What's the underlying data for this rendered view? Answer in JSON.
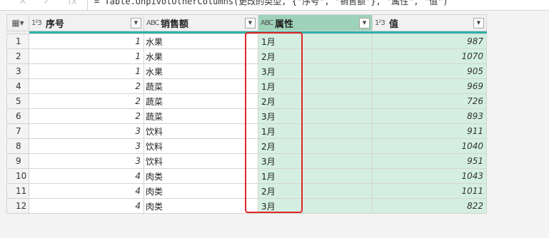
{
  "formula_bar": {
    "text": "= Table.UnpivotOtherColumns(更改的类型, {\"序号\", \"销售额\"}, \"属性\", \"值\")",
    "cancel_icon": "close-icon",
    "confirm_icon": "check-icon",
    "fx_label": "fx"
  },
  "columns": [
    {
      "type_label": "1²3",
      "label": "序号"
    },
    {
      "type_label": "ABC",
      "label": "销售额"
    },
    {
      "type_label": "ABC",
      "label": "属性"
    },
    {
      "type_label": "1²3",
      "label": "值"
    }
  ],
  "rows": [
    {
      "n": "1",
      "seq": "1",
      "cat": "水果",
      "attr": "1月",
      "val": "987"
    },
    {
      "n": "2",
      "seq": "1",
      "cat": "水果",
      "attr": "2月",
      "val": "1070"
    },
    {
      "n": "3",
      "seq": "1",
      "cat": "水果",
      "attr": "3月",
      "val": "905"
    },
    {
      "n": "4",
      "seq": "2",
      "cat": "蔬菜",
      "attr": "1月",
      "val": "969"
    },
    {
      "n": "5",
      "seq": "2",
      "cat": "蔬菜",
      "attr": "2月",
      "val": "726"
    },
    {
      "n": "6",
      "seq": "2",
      "cat": "蔬菜",
      "attr": "3月",
      "val": "893"
    },
    {
      "n": "7",
      "seq": "3",
      "cat": "饮料",
      "attr": "1月",
      "val": "911"
    },
    {
      "n": "8",
      "seq": "3",
      "cat": "饮料",
      "attr": "2月",
      "val": "1040"
    },
    {
      "n": "9",
      "seq": "3",
      "cat": "饮料",
      "attr": "3月",
      "val": "951"
    },
    {
      "n": "10",
      "seq": "4",
      "cat": "肉类",
      "attr": "1月",
      "val": "1043"
    },
    {
      "n": "11",
      "seq": "4",
      "cat": "肉类",
      "attr": "2月",
      "val": "1011"
    },
    {
      "n": "12",
      "seq": "4",
      "cat": "肉类",
      "attr": "3月",
      "val": "822"
    }
  ],
  "colors": {
    "selected_header": "#9ed3b9",
    "selected_cells": "#d4efe2",
    "accent_bar": "#2fb1a6",
    "highlight_border": "#e02626"
  }
}
